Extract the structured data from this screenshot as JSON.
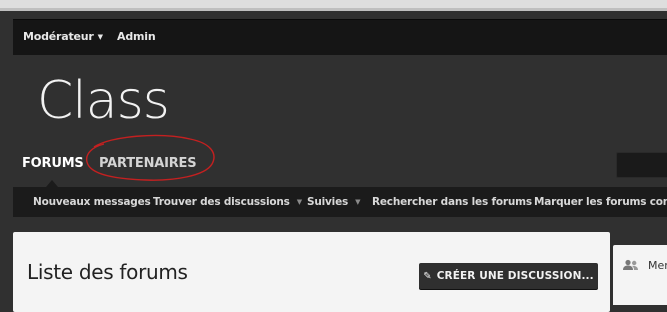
{
  "adminbar": {
    "moderator_label": "Modérateur",
    "admin_label": "Admin"
  },
  "header": {
    "logo_text": "Class"
  },
  "nav": {
    "tabs": [
      {
        "label": "FORUMS",
        "selected": true
      },
      {
        "label": "PARTENAIRES",
        "selected": false
      }
    ]
  },
  "subnav": {
    "links": [
      {
        "label": "Nouveaux messages",
        "has_dropdown": false
      },
      {
        "label": "Trouver des discussions",
        "has_dropdown": true
      },
      {
        "label": "Suivies",
        "has_dropdown": true
      },
      {
        "label": "Rechercher dans les forums",
        "has_dropdown": false
      },
      {
        "label": "Marquer les forums comm",
        "has_dropdown": false
      }
    ]
  },
  "main": {
    "title": "Liste des forums",
    "create_button_label": "CRÉER UNE DISCUSSION..."
  },
  "sidebar": {
    "label": "Mer"
  },
  "colors": {
    "background": "#303030",
    "bar": "#151515",
    "panel": "#f4f4f4",
    "annotation": "#c42020"
  },
  "icons": [
    "caret-down-icon",
    "pencil-icon",
    "users-icon"
  ]
}
